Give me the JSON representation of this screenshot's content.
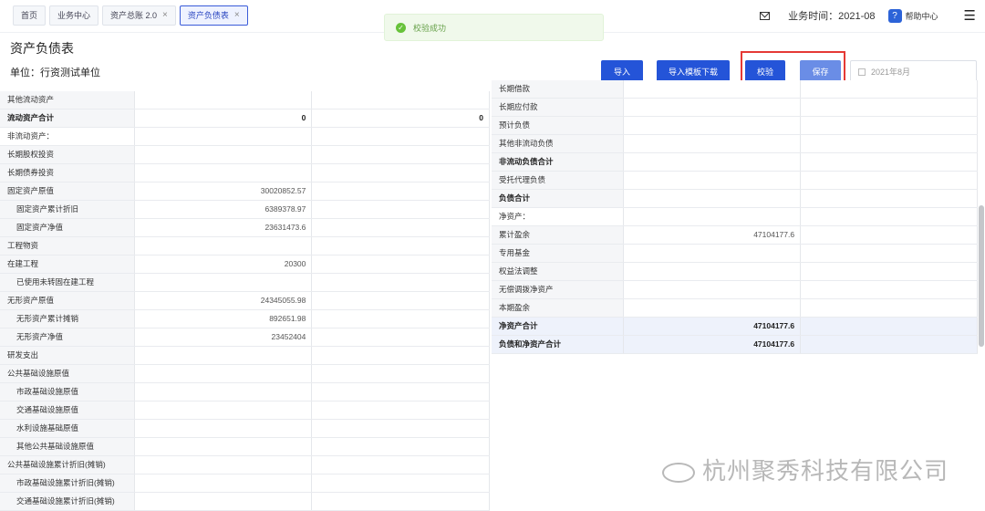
{
  "tabs": [
    {
      "label": "首页",
      "closable": false,
      "active": false
    },
    {
      "label": "业务中心",
      "closable": false,
      "active": false
    },
    {
      "label": "资产总账 2.0",
      "closable": true,
      "active": false
    },
    {
      "label": "资产负债表",
      "closable": true,
      "active": true
    }
  ],
  "toast": {
    "text": "校验成功",
    "icon": "check-icon"
  },
  "header": {
    "business_time_label": "业务时间：",
    "business_time_value": "2021-08",
    "help_label": "帮助中心"
  },
  "page": {
    "title": "资产负债表",
    "unit": "单位：行资测试单位"
  },
  "buttons": {
    "import": "导入",
    "template": "导入模板下载",
    "verify": "校验",
    "save": "保存"
  },
  "date_picker": {
    "placeholder": "2021年8月"
  },
  "left_rows": [
    {
      "label": "其他流动资产",
      "v1": "",
      "v2": ""
    },
    {
      "label": "流动资产合计",
      "v1": "0",
      "v2": "0",
      "bold": true
    },
    {
      "label": "非流动资产：",
      "v1": "",
      "v2": "",
      "section": true
    },
    {
      "label": "长期股权投资",
      "v1": "",
      "v2": ""
    },
    {
      "label": "长期债券投资",
      "v1": "",
      "v2": ""
    },
    {
      "label": "固定资产原值",
      "v1": "30020852.57",
      "v2": ""
    },
    {
      "label": "固定资产累计折旧",
      "v1": "6389378.97",
      "v2": "",
      "indent": true
    },
    {
      "label": "固定资产净值",
      "v1": "23631473.6",
      "v2": "",
      "indent": true
    },
    {
      "label": "工程物资",
      "v1": "",
      "v2": ""
    },
    {
      "label": "在建工程",
      "v1": "20300",
      "v2": ""
    },
    {
      "label": "已使用未转固在建工程",
      "v1": "",
      "v2": "",
      "indent": true
    },
    {
      "label": "无形资产原值",
      "v1": "24345055.98",
      "v2": ""
    },
    {
      "label": "无形资产累计摊销",
      "v1": "892651.98",
      "v2": "",
      "indent": true
    },
    {
      "label": "无形资产净值",
      "v1": "23452404",
      "v2": "",
      "indent": true
    },
    {
      "label": "研发支出",
      "v1": "",
      "v2": ""
    },
    {
      "label": "公共基础设施原值",
      "v1": "",
      "v2": ""
    },
    {
      "label": "市政基础设施原值",
      "v1": "",
      "v2": "",
      "indent": true
    },
    {
      "label": "交通基础设施原值",
      "v1": "",
      "v2": "",
      "indent": true
    },
    {
      "label": "水利设施基础原值",
      "v1": "",
      "v2": "",
      "indent": true
    },
    {
      "label": "其他公共基础设施原值",
      "v1": "",
      "v2": "",
      "indent": true
    },
    {
      "label": "公共基础设施累计折旧(摊销)",
      "v1": "",
      "v2": ""
    },
    {
      "label": "市政基础设施累计折旧(摊销)",
      "v1": "",
      "v2": "",
      "indent": true
    },
    {
      "label": "交通基础设施累计折旧(摊销)",
      "v1": "",
      "v2": "",
      "indent": true
    }
  ],
  "right_rows": [
    {
      "label": "长期借款",
      "v1": "",
      "v2": ""
    },
    {
      "label": "长期应付款",
      "v1": "",
      "v2": ""
    },
    {
      "label": "预计负债",
      "v1": "",
      "v2": ""
    },
    {
      "label": "其他非流动负债",
      "v1": "",
      "v2": ""
    },
    {
      "label": "非流动负债合计",
      "v1": "",
      "v2": "",
      "bold": true
    },
    {
      "label": "受托代理负债",
      "v1": "",
      "v2": ""
    },
    {
      "label": "负债合计",
      "v1": "",
      "v2": "",
      "bold": true
    },
    {
      "label": "净资产：",
      "v1": "",
      "v2": "",
      "section": true
    },
    {
      "label": "累计盈余",
      "v1": "47104177.6",
      "v2": ""
    },
    {
      "label": "专用基金",
      "v1": "",
      "v2": ""
    },
    {
      "label": "权益法调整",
      "v1": "",
      "v2": ""
    },
    {
      "label": "无偿调拨净资产",
      "v1": "",
      "v2": ""
    },
    {
      "label": "本期盈余",
      "v1": "",
      "v2": ""
    },
    {
      "label": "净资产合计",
      "v1": "47104177.6",
      "v2": "",
      "bold": true,
      "total": true
    },
    {
      "label": "负债和净资产合计",
      "v1": "47104177.6",
      "v2": "",
      "bold": true,
      "total": true
    }
  ],
  "watermark": {
    "company": "杭州聚秀科技有限公司"
  }
}
